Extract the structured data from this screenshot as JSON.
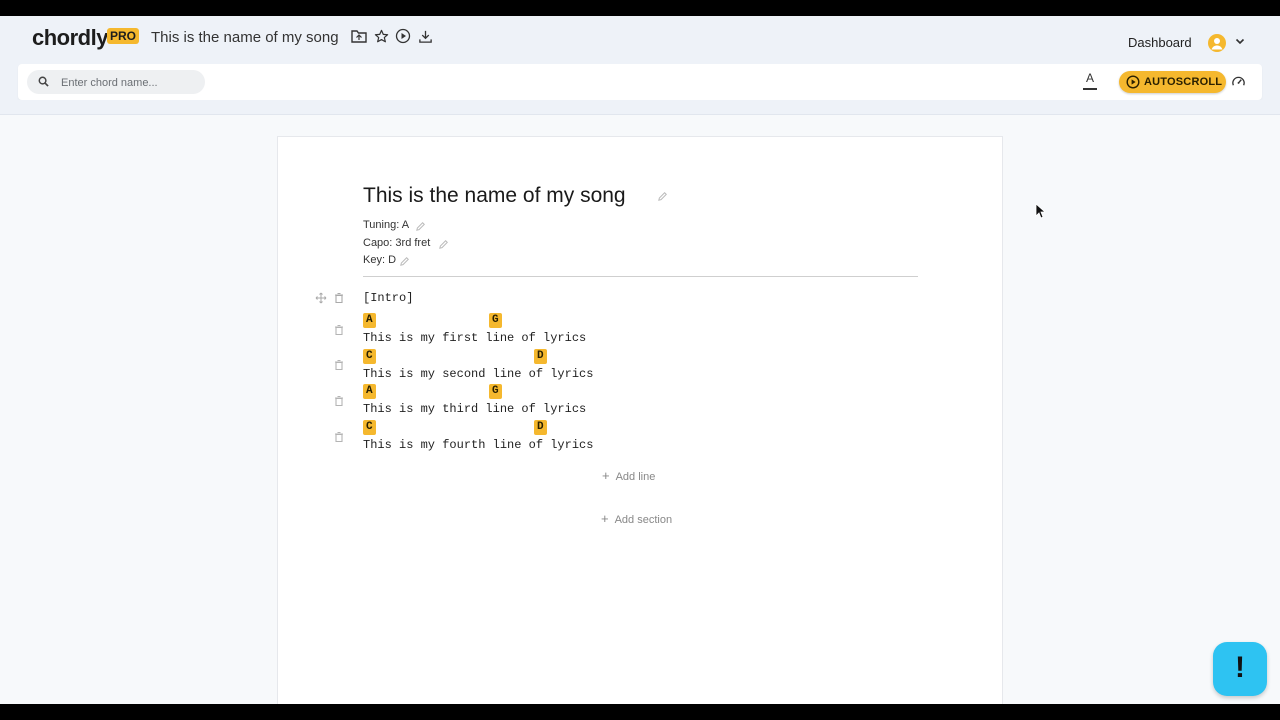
{
  "app": {
    "logo": "chordly",
    "badge": "PRO",
    "song_title": "This is the name of my song",
    "dashboard_label": "Dashboard"
  },
  "toolbar": {
    "search_placeholder": "Enter chord name...",
    "font_size_label": "A",
    "autoscroll_label": "AUTOSCROLL"
  },
  "sheet": {
    "title": "This is the name of my song",
    "tuning": "Tuning: A",
    "capo": "Capo: 3rd fret",
    "key": "Key: D",
    "section_label": "[Intro]",
    "lines": [
      {
        "chords": [
          "A",
          "G"
        ],
        "lyrics": "This is my first line of lyrics"
      },
      {
        "chords": [
          "C",
          "D"
        ],
        "lyrics": "This is my second line of lyrics"
      },
      {
        "chords": [
          "A",
          "G"
        ],
        "lyrics": "This is my third line of lyrics"
      },
      {
        "chords": [
          "C",
          "D"
        ],
        "lyrics": "This is my fourth line of lyrics"
      }
    ],
    "add_line_label": "Add line",
    "add_section_label": "Add section"
  },
  "help": {
    "label": "!"
  },
  "colors": {
    "accent": "#f5b82e",
    "help_button": "#2ec3f2",
    "background": "#eef2f8"
  },
  "icons": [
    "folder-icon",
    "star-icon",
    "play-icon",
    "download-icon",
    "user-avatar-icon",
    "chevron-down-icon",
    "search-icon",
    "font-size-icon",
    "play-circle-icon",
    "speedometer-icon",
    "pencil-icon",
    "move-icon",
    "trash-icon",
    "plus-icon",
    "cursor-icon"
  ]
}
